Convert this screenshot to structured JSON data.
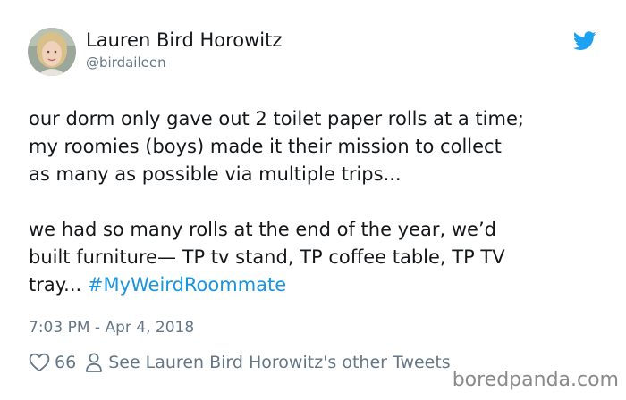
{
  "author": {
    "name": "Lauren Bird Horowitz",
    "handle": "@birdaileen"
  },
  "tweet": {
    "paragraph1": [
      "our dorm only gave out 2 toilet paper rolls at a time;",
      "my roomies (boys) made it their mission to collect",
      "as many as possible via multiple trips..."
    ],
    "paragraph2": [
      "we had so many rolls at the end of the year, we’d",
      "built furniture— TP tv stand, TP coffee table, TP TV"
    ],
    "last_line_text": "tray... ",
    "hashtag": "#MyWeirdRoommate",
    "timestamp": "7:03 PM - Apr 4, 2018"
  },
  "footer": {
    "likes": "66",
    "other_tweets_label": "See Lauren Bird Horowitz's other Tweets"
  },
  "watermark": "boredpanda.com",
  "icons": {
    "brand": "twitter-bird-icon",
    "like": "heart-icon",
    "profile": "person-icon"
  },
  "colors": {
    "link": "#1b95e0",
    "secondary_text": "#657786",
    "twitter_blue": "#1da1f2"
  }
}
